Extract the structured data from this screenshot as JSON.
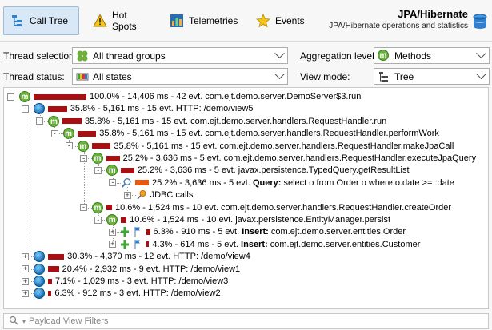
{
  "toolbar": {
    "call_tree": "Call Tree",
    "hot_spots": "Hot Spots",
    "telemetries": "Telemetries",
    "events": "Events",
    "title": "JPA/Hibernate",
    "subtitle": "JPA/Hibernate operations and statistics"
  },
  "settings": {
    "thread_selection_label": "Thread selection:",
    "thread_selection_value": "All thread groups",
    "aggregation_label": "Aggregation level:",
    "aggregation_value": "Methods",
    "thread_status_label": "Thread status:",
    "thread_status_value": "All states",
    "view_mode_label": "View mode:",
    "view_mode_value": "Tree"
  },
  "tree": [
    {
      "text": "100.0% - 14,406 ms - 42 evt. com.ejt.demo.server.DemoServer$3.run",
      "icon": "m",
      "bar": 1.0,
      "depth": 0,
      "expander": "-"
    },
    {
      "text": "35.8% - 5,161 ms - 15 evt. HTTP: /demo/view5",
      "icon": "globe",
      "bar": 0.358,
      "depth": 1,
      "expander": "-"
    },
    {
      "text": "35.8% - 5,161 ms - 15 evt. com.ejt.demo.server.handlers.RequestHandler.run",
      "icon": "m",
      "bar": 0.358,
      "depth": 2,
      "expander": "-"
    },
    {
      "text": "35.8% - 5,161 ms - 15 evt. com.ejt.demo.server.handlers.RequestHandler.performWork",
      "icon": "m",
      "bar": 0.358,
      "depth": 3,
      "expander": "-"
    },
    {
      "text": "35.8% - 5,161 ms - 15 evt. com.ejt.demo.server.handlers.RequestHandler.makeJpaCall",
      "icon": "m",
      "bar": 0.358,
      "depth": 4,
      "expander": "-"
    },
    {
      "text": "25.2% - 3,636 ms - 5 evt. com.ejt.demo.server.handlers.RequestHandler.executeJpaQuery",
      "icon": "m",
      "bar": 0.252,
      "depth": 5,
      "expander": "-"
    },
    {
      "text": "25.2% - 3,636 ms - 5 evt. javax.persistence.TypedQuery.getResultList",
      "icon": "m",
      "bar": 0.252,
      "depth": 6,
      "expander": "-"
    },
    {
      "text_pre": "25.2% - 3,636 ms - 5 evt. ",
      "text_bold": "Query:",
      "text_post": " select o from Order o where o.date >= :date",
      "icon": "search",
      "bar": 0.252,
      "bar_color": "orange",
      "depth": 7,
      "expander": "-"
    },
    {
      "text": "JDBC calls",
      "icon": "pin",
      "bar": 0,
      "depth": 8,
      "expander": "+"
    },
    {
      "text": "10.6% - 1,524 ms - 10 evt. com.ejt.demo.server.handlers.RequestHandler.createOrder",
      "icon": "m",
      "bar": 0.106,
      "depth": 5,
      "expander": "-"
    },
    {
      "text": "10.6% - 1,524 ms - 10 evt. javax.persistence.EntityManager.persist",
      "icon": "m",
      "bar": 0.106,
      "depth": 6,
      "expander": "-"
    },
    {
      "text_pre": "6.3% - 910 ms - 5 evt. ",
      "text_bold": "Insert:",
      "text_post": " com.ejt.demo.server.entities.Order",
      "icon": "insert",
      "bar": 0.063,
      "depth": 7,
      "expander": "+"
    },
    {
      "text_pre": "4.3% - 614 ms - 5 evt. ",
      "text_bold": "Insert:",
      "text_post": " com.ejt.demo.server.entities.Customer",
      "icon": "insert",
      "bar": 0.043,
      "depth": 7,
      "expander": "+"
    },
    {
      "text": "30.3% - 4,370 ms - 12 evt. HTTP: /demo/view4",
      "icon": "globe",
      "bar": 0.303,
      "depth": 1,
      "expander": "+"
    },
    {
      "text": "20.4% - 2,932 ms - 9 evt. HTTP: /demo/view1",
      "icon": "globe",
      "bar": 0.204,
      "depth": 1,
      "expander": "+"
    },
    {
      "text": "7.1% - 1,029 ms - 3 evt. HTTP: /demo/view3",
      "icon": "globe",
      "bar": 0.071,
      "depth": 1,
      "expander": "+"
    },
    {
      "text": "6.3% - 912 ms - 3 evt. HTTP: /demo/view2",
      "icon": "globe",
      "bar": 0.063,
      "depth": 1,
      "expander": "+"
    }
  ],
  "filter": {
    "placeholder": "Payload View Filters"
  },
  "colors": {
    "bar": "#a80f12",
    "bar_highlight": "#e8570e",
    "selected_tab": "#d9e8f6"
  }
}
